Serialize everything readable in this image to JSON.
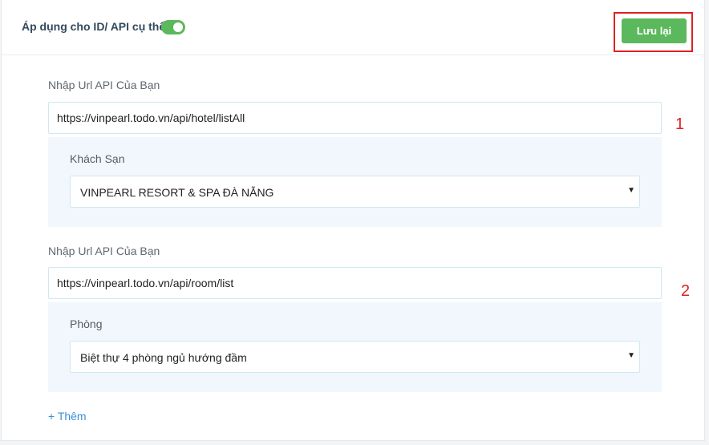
{
  "header": {
    "title": "Áp dụng cho ID/ API cụ thể",
    "toggle_on": true,
    "save_label": "Lưu lại"
  },
  "groups": [
    {
      "url_label": "Nhập Url API Của Bạn",
      "url_value": "https://vinpearl.todo.vn/api/hotel/listAll",
      "field_label": "Khách Sạn",
      "selected": "VINPEARL RESORT & SPA ĐÀ NẴNG",
      "marker": "1"
    },
    {
      "url_label": "Nhập Url API Của Bạn",
      "url_value": "https://vinpearl.todo.vn/api/room/list",
      "field_label": "Phòng",
      "selected": "Biệt thự 4 phòng ngủ hướng đầm",
      "marker": "2"
    }
  ],
  "add_label": "+ Thêm",
  "colors": {
    "accent_green": "#5cb85c",
    "highlight_red": "#e02020",
    "link_blue": "#3a8fd8",
    "sub_box_bg": "#f1f7fd"
  },
  "icons": {
    "caret": "caret-down-icon"
  }
}
